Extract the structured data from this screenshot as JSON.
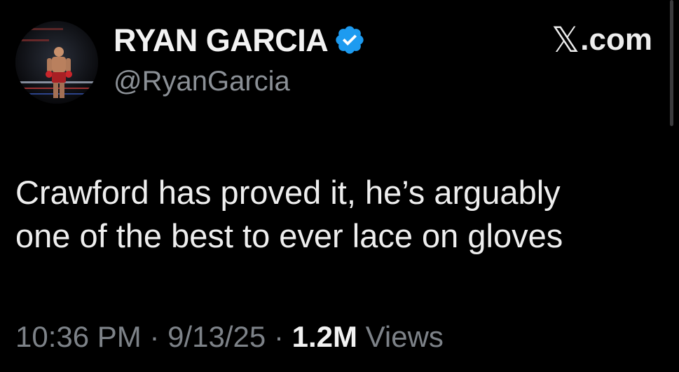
{
  "author": {
    "display_name": "RYAN GARCIA",
    "handle": "@RyanGarcia",
    "verified": true,
    "avatar_icon": "boxer-in-ring-avatar"
  },
  "source_label": "𝕏.com",
  "source_glyph": "𝕏",
  "source_text": ".com",
  "tweet": {
    "lines": [
      "Crawford has proved it, he’s arguably",
      "one of the best to ever lace on gloves"
    ]
  },
  "meta": {
    "time": "10:36 PM",
    "sep1": "·",
    "date": "9/13/25",
    "sep2": "·",
    "views_count": "1.2M",
    "views_label": "Views"
  },
  "colors": {
    "background": "#000000",
    "verified_badge": "#1d9bf0",
    "secondary_text": "#8b9096",
    "primary_text": "#eeeeee"
  }
}
